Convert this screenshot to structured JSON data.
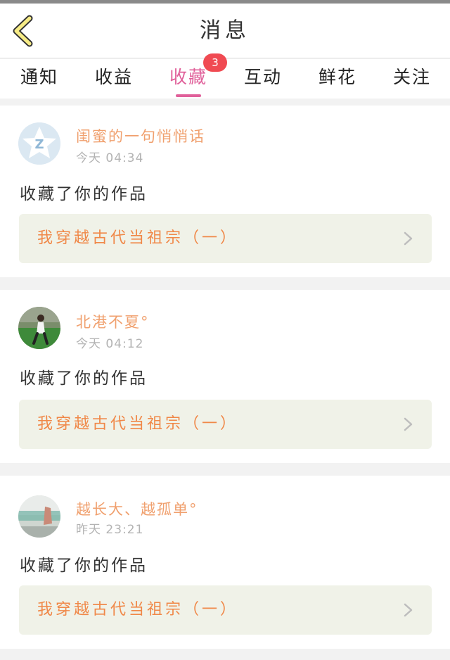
{
  "header": {
    "title": "消息"
  },
  "tabs": [
    {
      "label": "通知"
    },
    {
      "label": "收益"
    },
    {
      "label": "收藏"
    },
    {
      "label": "互动"
    },
    {
      "label": "鲜花"
    },
    {
      "label": "关注"
    }
  ],
  "active_tab": "收藏",
  "badge": {
    "count": "3"
  },
  "colors": {
    "accent": "#e0609a",
    "badge": "#f04a52",
    "username": "#f0a06e",
    "work_title": "#f08848",
    "work_box_bg": "#f0f2e8"
  },
  "items": [
    {
      "user": "闺蜜的一句悄悄话",
      "time": "今天 04:34",
      "action": "收藏了你的作品",
      "work_title": "我穿越古代当祖宗（一）",
      "avatar_icon": "z-star-default-avatar-icon"
    },
    {
      "user": "北港不夏°",
      "time": "今天 04:12",
      "action": "收藏了你的作品",
      "work_title": "我穿越古代当祖宗（一）",
      "avatar_icon": "photo-avatar-icon"
    },
    {
      "user": "越长大、越孤单°",
      "time": "昨天 23:21",
      "action": "收藏了你的作品",
      "work_title": "我穿越古代当祖宗（一）",
      "avatar_icon": "photo-avatar-icon"
    }
  ]
}
